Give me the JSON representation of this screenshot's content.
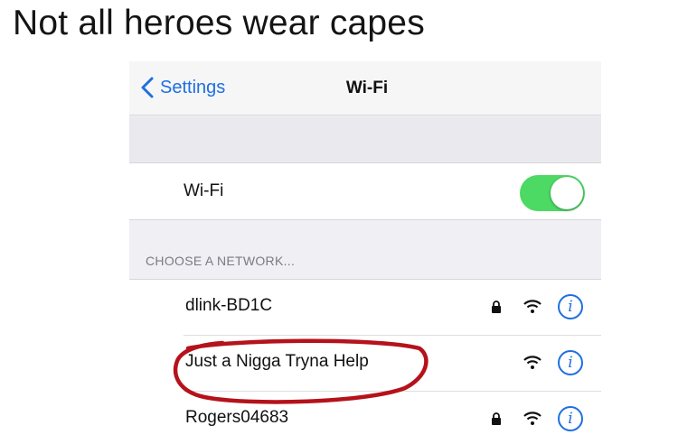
{
  "caption": "Not all heroes wear capes",
  "navbar": {
    "back_label": "Settings",
    "title": "Wi-Fi"
  },
  "wifi_toggle": {
    "label": "Wi-Fi",
    "on": true,
    "color": "#4cd964"
  },
  "section_header": "CHOOSE A NETWORK...",
  "networks": [
    {
      "name": "dlink-BD1C",
      "secured": true
    },
    {
      "name": "Just a Nigga Tryna Help",
      "secured": false,
      "highlighted": true
    },
    {
      "name": "Rogers04683",
      "secured": true
    }
  ],
  "colors": {
    "accent": "#1e6fe0",
    "annotation": "#b5121b"
  },
  "icons": [
    "chevron-left-icon",
    "lock-icon",
    "wifi-signal-icon",
    "info-icon"
  ]
}
